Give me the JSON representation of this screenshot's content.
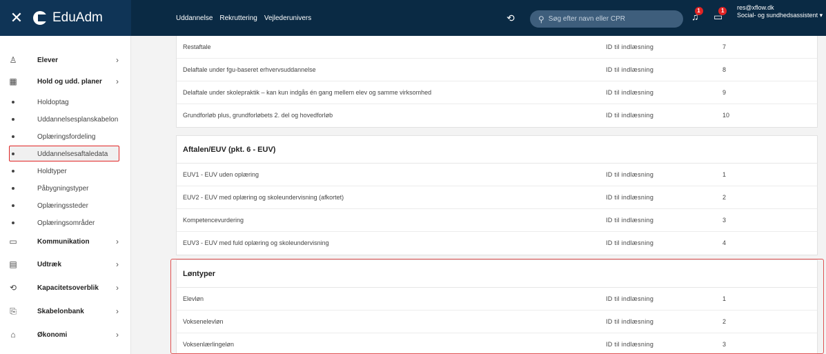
{
  "app": {
    "close": "✕",
    "name": "EduAdm"
  },
  "topnav": {
    "items": [
      "Uddannelse",
      "Rekruttering",
      "Vejlederunivers"
    ]
  },
  "search": {
    "placeholder": "Søg efter navn eller CPR"
  },
  "notifications": {
    "bell_badge": "1",
    "chat_badge": "1"
  },
  "user": {
    "email": "res@xflow.dk",
    "role": "Social- og sundhedsassistent ▾"
  },
  "sidebar": {
    "items": [
      {
        "label": "Elever",
        "icon": "user-icon",
        "glyph": "♙",
        "chevron": "›"
      },
      {
        "label": "Hold og udd. planer",
        "icon": "calendar-icon",
        "glyph": "▦",
        "chevron": "›"
      },
      {
        "label": "Holdoptag"
      },
      {
        "label": "Uddannelsesplanskabelon"
      },
      {
        "label": "Oplæringsfordeling"
      },
      {
        "label": "Uddannelsesaftaledata"
      },
      {
        "label": "Holdtyper"
      },
      {
        "label": "Påbygningstyper"
      },
      {
        "label": "Oplæringssteder"
      },
      {
        "label": "Oplæringsområder"
      },
      {
        "label": "Kommunikation",
        "icon": "chat-icon",
        "glyph": "▭",
        "chevron": "›"
      },
      {
        "label": "Udtræk",
        "icon": "export-icon",
        "glyph": "▤",
        "chevron": "›"
      },
      {
        "label": "Kapacitetsoverblik",
        "icon": "capacity-icon",
        "glyph": "⟲",
        "chevron": "›"
      },
      {
        "label": "Skabelonbank",
        "icon": "template-icon",
        "glyph": "⎘",
        "chevron": "›"
      },
      {
        "label": "Økonomi",
        "icon": "bag-icon",
        "glyph": "⌂",
        "chevron": "›"
      }
    ]
  },
  "cards": [
    {
      "title": "",
      "rows": [
        {
          "name": "Restaftale",
          "id": "ID til indlæsning",
          "num": "7"
        },
        {
          "name": "Delaftale under fgu-baseret erhvervsuddannelse",
          "id": "ID til indlæsning",
          "num": "8"
        },
        {
          "name": "Delaftale under skolepraktik – kan kun indgås én gang mellem elev og samme virksomhed",
          "id": "ID til indlæsning",
          "num": "9"
        },
        {
          "name": "Grundforløb plus, grundforløbets 2. del og hovedforløb",
          "id": "ID til indlæsning",
          "num": "10"
        }
      ]
    },
    {
      "title": "Aftalen/EUV (pkt. 6 - EUV)",
      "rows": [
        {
          "name": "EUV1 - EUV uden oplæring",
          "id": "ID til indlæsning",
          "num": "1"
        },
        {
          "name": "EUV2 - EUV med oplæring og skoleundervisning (afkortet)",
          "id": "ID til indlæsning",
          "num": "2"
        },
        {
          "name": "Kompetencevurdering",
          "id": "ID til indlæsning",
          "num": "3"
        },
        {
          "name": "EUV3 - EUV med fuld oplæring og skoleundervisning",
          "id": "ID til indlæsning",
          "num": "4"
        }
      ]
    },
    {
      "title": "Løntyper",
      "rows": [
        {
          "name": "Elevløn",
          "id": "ID til indlæsning",
          "num": "1"
        },
        {
          "name": "Voksenelevløn",
          "id": "ID til indlæsning",
          "num": "2"
        },
        {
          "name": "Voksenlærlingeløn",
          "id": "ID til indlæsning",
          "num": "3"
        }
      ]
    }
  ]
}
